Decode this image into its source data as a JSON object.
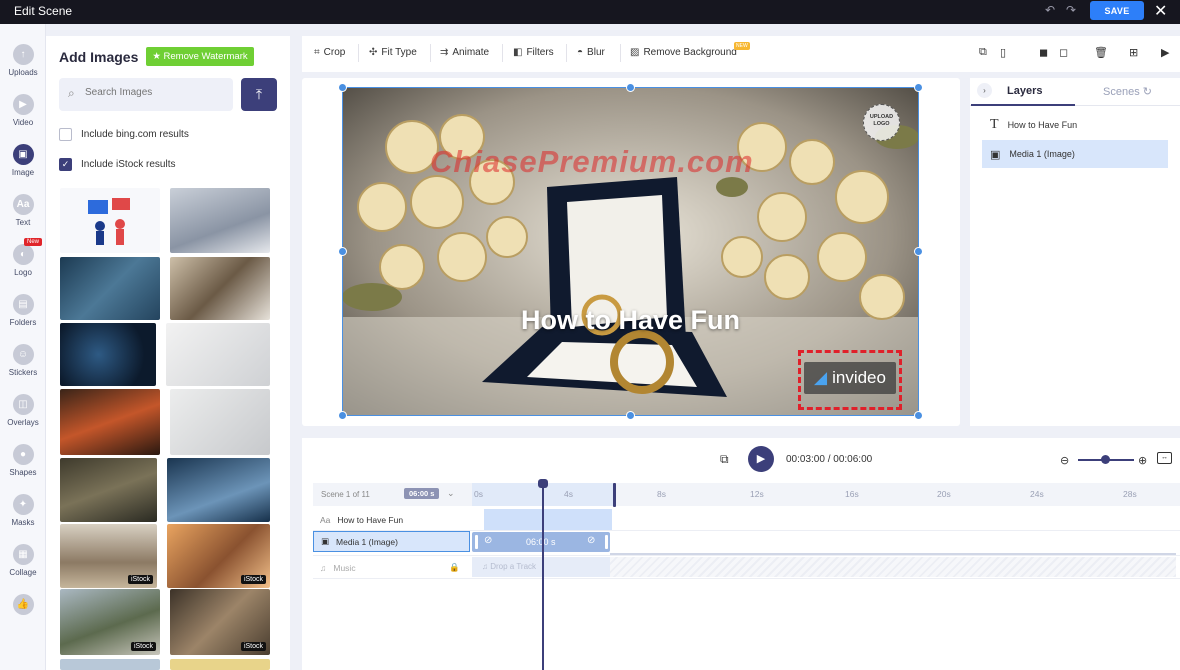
{
  "window": {
    "title": "Edit Scene",
    "save_label": "SAVE"
  },
  "rail": [
    {
      "label": "Uploads",
      "icon": "upload-icon"
    },
    {
      "label": "Video",
      "icon": "video-icon"
    },
    {
      "label": "Image",
      "icon": "image-icon"
    },
    {
      "label": "Text",
      "icon": "text-icon"
    },
    {
      "label": "Logo",
      "icon": "logo-icon",
      "badge": "New"
    },
    {
      "label": "Folders",
      "icon": "folder-icon"
    },
    {
      "label": "Stickers",
      "icon": "sticker-icon"
    },
    {
      "label": "Overlays",
      "icon": "overlay-icon"
    },
    {
      "label": "Shapes",
      "icon": "shape-icon"
    },
    {
      "label": "Masks",
      "icon": "mask-icon"
    },
    {
      "label": "Collage",
      "icon": "collage-icon"
    }
  ],
  "panel": {
    "title": "Add Images",
    "watermark_button": "Remove Watermark",
    "search_placeholder": "Search Images",
    "option_bing": "Include bing.com results",
    "option_istock": "Include iStock results",
    "istock_badge": "iStock"
  },
  "toolbar": {
    "crop": "Crop",
    "fit_type": "Fit Type",
    "animate": "Animate",
    "filters": "Filters",
    "blur": "Blur",
    "remove_background": "Remove Background",
    "new_tag": "NEW"
  },
  "canvas": {
    "headline": "How to Have Fun",
    "watermark": "ChiasePremium.com",
    "upload_logo": "UPLOAD LOGO",
    "brand": "invideo"
  },
  "layers": {
    "tab_layers": "Layers",
    "tab_scenes": "Scenes",
    "items": [
      "How to Have Fun",
      "Media 1 (Image)"
    ]
  },
  "playback": {
    "time": "00:03:00 / 00:06:00"
  },
  "timeline": {
    "scene_label": "Scene 1 of 11",
    "duration": "06:00 s",
    "ticks": [
      "0s",
      "4s",
      "8s",
      "12s",
      "16s",
      "20s",
      "24s",
      "28s"
    ],
    "rows": [
      "How to Have Fun",
      "Media 1 (Image)",
      "Music"
    ],
    "clip_label": "06:00 s",
    "music_clip": "Drop a Track"
  },
  "colors": {
    "accent": "#3c3f7a",
    "save": "#2d7ff9",
    "selection": "#4a90e2",
    "watermark_button": "#6fcf34"
  }
}
